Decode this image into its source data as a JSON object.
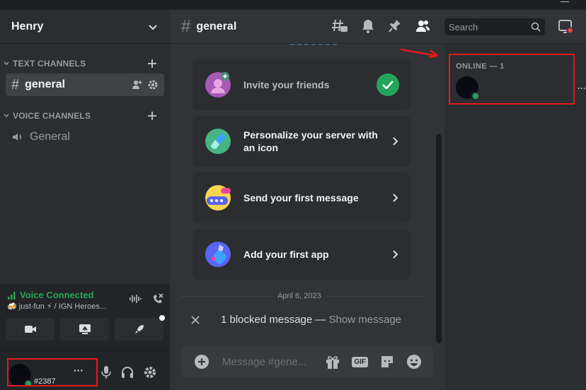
{
  "server": {
    "name": "Henry"
  },
  "sidebar": {
    "text_category": "TEXT CHANNELS",
    "text_channels": [
      {
        "name": "general"
      }
    ],
    "voice_category": "VOICE CHANNELS",
    "voice_channels": [
      {
        "name": "General"
      }
    ]
  },
  "voice": {
    "status": "Voice Connected",
    "detail": "🍻 just-fun ⚡ / IGN Heroes..."
  },
  "user": {
    "tag": "#2387",
    "more": "···"
  },
  "channel": {
    "name": "general"
  },
  "search": {
    "placeholder": "Search"
  },
  "onboarding": {
    "cards": [
      {
        "label": "Invite your friends",
        "done": true
      },
      {
        "label": "Personalize your server with an icon",
        "done": false
      },
      {
        "label": "Send your first message",
        "done": false
      },
      {
        "label": "Add your first app",
        "done": false
      }
    ]
  },
  "messages": {
    "date_divider": "April 6, 2023",
    "blocked_text": "1 blocked message — ",
    "show_link": "Show message"
  },
  "composer": {
    "placeholder": "Message #gene...",
    "gif": "GIF"
  },
  "members": {
    "online_label": "ONLINE — 1",
    "more": "···"
  },
  "colors": {
    "accent_green": "#23a55a",
    "highlight_red": "#e61919",
    "notification_red": "#f23f43"
  }
}
